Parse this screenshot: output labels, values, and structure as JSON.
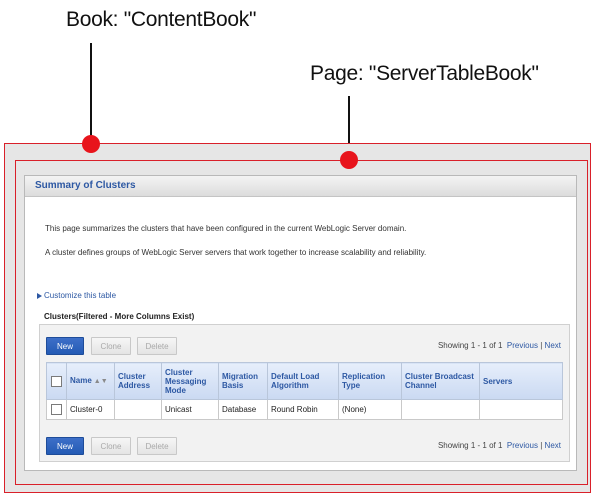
{
  "annotations": {
    "book_label": "Book: \"ContentBook\"",
    "page_label": "Page: \"ServerTableBook\""
  },
  "panel": {
    "title": "Summary of Clusters",
    "desc1": "This page summarizes the clusters that have been configured in the current WebLogic Server domain.",
    "desc2": "A cluster defines groups of WebLogic Server servers that work together to increase scalability and reliability.",
    "customize_link": "Customize this table",
    "section_label": "Clusters(Filtered - More Columns Exist)"
  },
  "toolbar": {
    "new_label": "New",
    "clone_label": "Clone",
    "delete_label": "Delete",
    "showing": "Showing 1 - 1 of 1",
    "previous": "Previous",
    "separator": "|",
    "next": "Next"
  },
  "table": {
    "columns": [
      "Name",
      "Cluster Address",
      "Cluster Messaging Mode",
      "Migration Basis",
      "Default Load Algorithm",
      "Replication Type",
      "Cluster Broadcast Channel",
      "Servers"
    ],
    "rows": [
      {
        "name": "Cluster-0",
        "address": "",
        "messaging_mode": "Unicast",
        "migration_basis": "Database",
        "load_algorithm": "Round Robin",
        "replication_type": "(None)",
        "broadcast_channel": "",
        "servers": ""
      }
    ]
  },
  "colors": {
    "accent": "#e8141c",
    "link": "#2d58a3",
    "primary_button": "#245bb5"
  },
  "icons": [
    "sort-icon",
    "expand-triangle-icon",
    "checkbox"
  ]
}
